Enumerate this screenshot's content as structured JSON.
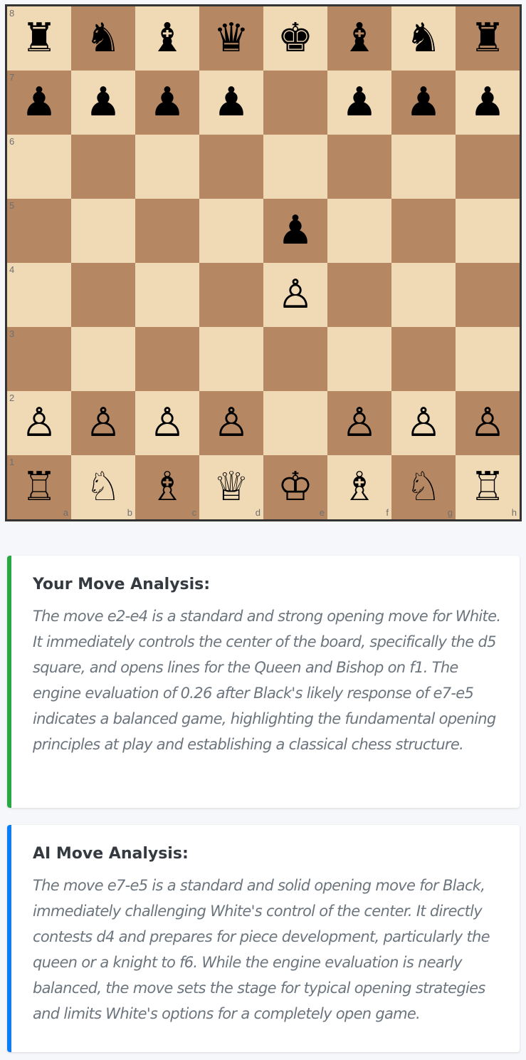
{
  "board": {
    "ranks": [
      "8",
      "7",
      "6",
      "5",
      "4",
      "3",
      "2",
      "1"
    ],
    "files": [
      "a",
      "b",
      "c",
      "d",
      "e",
      "f",
      "g",
      "h"
    ],
    "rows": [
      [
        "♜",
        "♞",
        "♝",
        "♛",
        "♚",
        "♝",
        "♞",
        "♜"
      ],
      [
        "♟",
        "♟",
        "♟",
        "♟",
        "",
        "♟",
        "♟",
        "♟"
      ],
      [
        "",
        "",
        "",
        "",
        "",
        "",
        "",
        ""
      ],
      [
        "",
        "",
        "",
        "",
        "♟",
        "",
        "",
        ""
      ],
      [
        "",
        "",
        "",
        "",
        "♙",
        "",
        "",
        ""
      ],
      [
        "",
        "",
        "",
        "",
        "",
        "",
        "",
        ""
      ],
      [
        "♙",
        "♙",
        "♙",
        "♙",
        "",
        "♙",
        "♙",
        "♙"
      ],
      [
        "♖",
        "♘",
        "♗",
        "♕",
        "♔",
        "♗",
        "♘",
        "♖"
      ]
    ],
    "light_color": "#f0d9b5",
    "dark_color": "#b58863"
  },
  "user_analysis": {
    "title": "Your Move Analysis:",
    "text": "The move e2-e4 is a standard and strong opening move for White. It immediately controls the center of the board, specifically the d5 square, and opens lines for the Queen and Bishop on f1. The engine evaluation of 0.26 after Black's likely response of e7-e5 indicates a balanced game, highlighting the fundamental opening principles at play and establishing a classical chess structure.",
    "accent_color": "#28a745"
  },
  "ai_analysis": {
    "title": "AI Move Analysis:",
    "text": "The move e7-e5 is a standard and solid opening move for Black, immediately challenging White's control of the center. It directly contests d4 and prepares for piece development, particularly the queen or a knight to f6. While the engine evaluation is nearly balanced, the move sets the stage for typical opening strategies and limits White's options for a completely open game.",
    "accent_color": "#0d7df5"
  }
}
